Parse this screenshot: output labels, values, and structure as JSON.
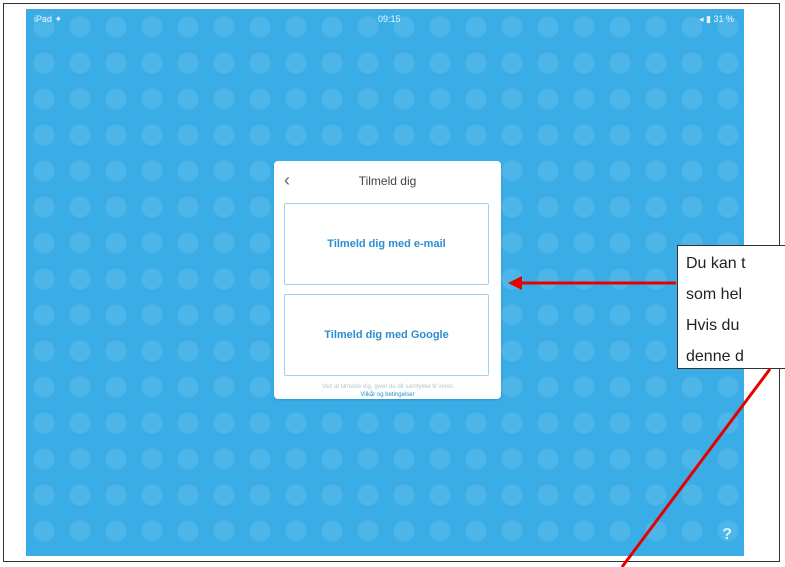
{
  "status_bar": {
    "carrier": "iPad ✦",
    "time": "09:15",
    "battery": "◂ ▮ 31 %"
  },
  "dialog": {
    "title": "Tilmeld dig",
    "back_icon": "chevron-left-icon",
    "options": [
      {
        "label": "Tilmeld dig med e-mail"
      },
      {
        "label": "Tilmeld dig med Google"
      }
    ],
    "terms_note": "Ved at tilmelde dig, giver du dit samtykke til vores",
    "terms_link": "Vilkår og betingelser"
  },
  "help_label": "?",
  "callout": {
    "lines": [
      "Du kan t",
      "som hel",
      "Hvis du",
      "denne d"
    ]
  },
  "colors": {
    "background": "#2ea8e6",
    "accent": "#2c8ed0",
    "annotation": "#e60000"
  }
}
